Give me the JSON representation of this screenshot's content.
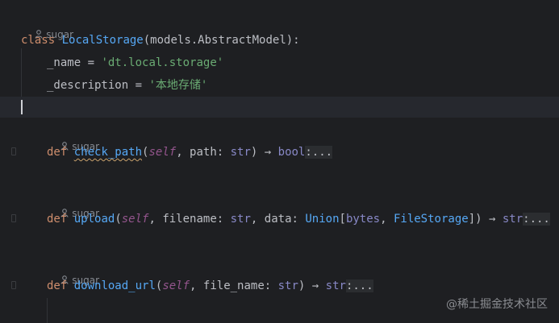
{
  "author_hints": {
    "class_author": "sugar",
    "check_path_author": "sugar",
    "upload_author": "sugar",
    "download_url_author": "sugar"
  },
  "code": {
    "class_line": {
      "kw": "class",
      "name": "LocalStorage",
      "args": "(models.AbstractModel):"
    },
    "name_line": {
      "attr": "_name",
      "eq": " = ",
      "value": "'dt.local.storage'"
    },
    "desc_line": {
      "attr": "_description",
      "eq": " = ",
      "value": "'本地存储'"
    },
    "check_path_line": {
      "kw": "def",
      "name": "check_path",
      "open": "(",
      "self": "self",
      "sep1": ", ",
      "p1": "path",
      "c1": ": ",
      "t1": "str",
      "close": ") → ",
      "ret": "bool",
      "fold": ":..."
    },
    "upload_line": {
      "kw": "def",
      "name": "upload",
      "open": "(",
      "self": "self",
      "sep1": ", ",
      "p1": "filename",
      "c1": ": ",
      "t1": "str",
      "sep2": ", ",
      "p2": "data",
      "c2": ": ",
      "t2": "Union",
      "b_open": "[",
      "t3": "bytes",
      "sep3": ", ",
      "t4": "FileStorage",
      "b_close": "]",
      "close": ") → ",
      "ret": "str",
      "fold": ":..."
    },
    "download_line": {
      "kw": "def",
      "name": "download_url",
      "open": "(",
      "self": "self",
      "sep1": ", ",
      "p1": "file_name",
      "c1": ": ",
      "t1": "str",
      "close": ") → ",
      "ret": "str",
      "fold": ":..."
    }
  },
  "watermark": "@稀土掘金技术社区",
  "colors": {
    "background": "#1e1f22",
    "keyword": "#cf8e6d",
    "function": "#56a8f5",
    "string": "#6aab73",
    "self": "#94558d",
    "current_line": "#26282e"
  }
}
